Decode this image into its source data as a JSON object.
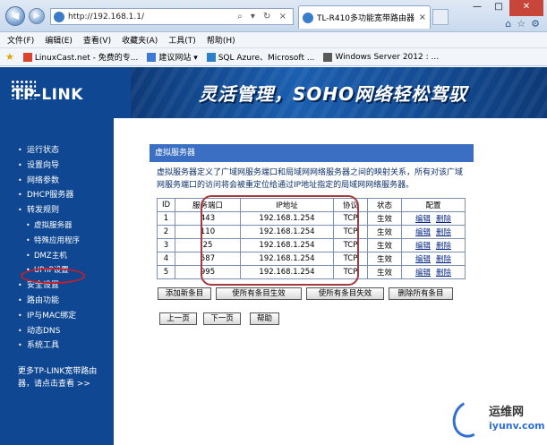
{
  "browser": {
    "address_url": "http://192.168.1.1/",
    "tab_title": "TL-R410多功能宽带路由器",
    "menu": [
      "文件(F)",
      "编辑(E)",
      "查看(V)",
      "收藏夹(A)",
      "工具(T)",
      "帮助(H)"
    ],
    "favorites": [
      "LinuxCast.net - 免费的专...",
      "建议网站 ▾",
      "SQL Azure、Microsoft ...",
      "Windows Server 2012 : ..."
    ],
    "colors": {
      "chrome": "#dfe9f5",
      "close": "#c8453a"
    }
  },
  "banner": {
    "logo_text": "TP-LINK",
    "slogan": "灵活管理，SOHO网络轻松驾驭",
    "colors": {
      "logo_bg": "#0f4793",
      "banner_bg": "#0d3d7e"
    }
  },
  "sidebar": {
    "items": [
      {
        "label": "运行状态",
        "level": 1
      },
      {
        "label": "设置向导",
        "level": 1
      },
      {
        "label": "网络参数",
        "level": 1
      },
      {
        "label": "DHCP服务器",
        "level": 1
      },
      {
        "label": "转发规则",
        "level": 1
      },
      {
        "label": "虚拟服务器",
        "level": 2,
        "active": true
      },
      {
        "label": "特殊应用程序",
        "level": 2
      },
      {
        "label": "DMZ主机",
        "level": 2
      },
      {
        "label": "UPnP设置",
        "level": 2
      },
      {
        "label": "安全设置",
        "level": 1
      },
      {
        "label": "路由功能",
        "level": 1
      },
      {
        "label": "IP与MAC绑定",
        "level": 1
      },
      {
        "label": "动态DNS",
        "level": 1
      },
      {
        "label": "系统工具",
        "level": 1
      }
    ],
    "more_text": "更多TP-LINK宽带路由器，请点击查看 >>"
  },
  "main": {
    "title": "虚拟服务器",
    "description": "虚拟服务器定义了广域网服务端口和局域网网络服务器之间的映射关系，所有对该广域网服务端口的访问将会被重定位给通过IP地址指定的局域网网络服务器。",
    "table": {
      "headers": [
        "ID",
        "服务端口",
        "IP地址",
        "协议",
        "状态",
        "配置"
      ],
      "rows": [
        {
          "id": "1",
          "port": "443",
          "ip": "192.168.1.254",
          "protocol": "TCP",
          "status": "生效",
          "edit": "编辑",
          "delete": "删除"
        },
        {
          "id": "2",
          "port": "110",
          "ip": "192.168.1.254",
          "protocol": "TCP",
          "status": "生效",
          "edit": "编辑",
          "delete": "删除"
        },
        {
          "id": "3",
          "port": "25",
          "ip": "192.168.1.254",
          "protocol": "TCP",
          "status": "生效",
          "edit": "编辑",
          "delete": "删除"
        },
        {
          "id": "4",
          "port": "587",
          "ip": "192.168.1.254",
          "protocol": "TCP",
          "status": "生效",
          "edit": "编辑",
          "delete": "删除"
        },
        {
          "id": "5",
          "port": "995",
          "ip": "192.168.1.254",
          "protocol": "TCP",
          "status": "生效",
          "edit": "编辑",
          "delete": "删除"
        }
      ]
    },
    "buttons": {
      "add": "添加新条目",
      "enable_all": "使所有条目生效",
      "disable_all": "使所有条目失效",
      "delete_all": "删除所有条目",
      "prev": "上一页",
      "next": "下一页",
      "help": "帮助"
    },
    "colors": {
      "panel_title": "#3a6fc4",
      "highlight": "#a4393f"
    }
  },
  "watermark": {
    "cn": "运维网",
    "en": "iyunv.com"
  }
}
